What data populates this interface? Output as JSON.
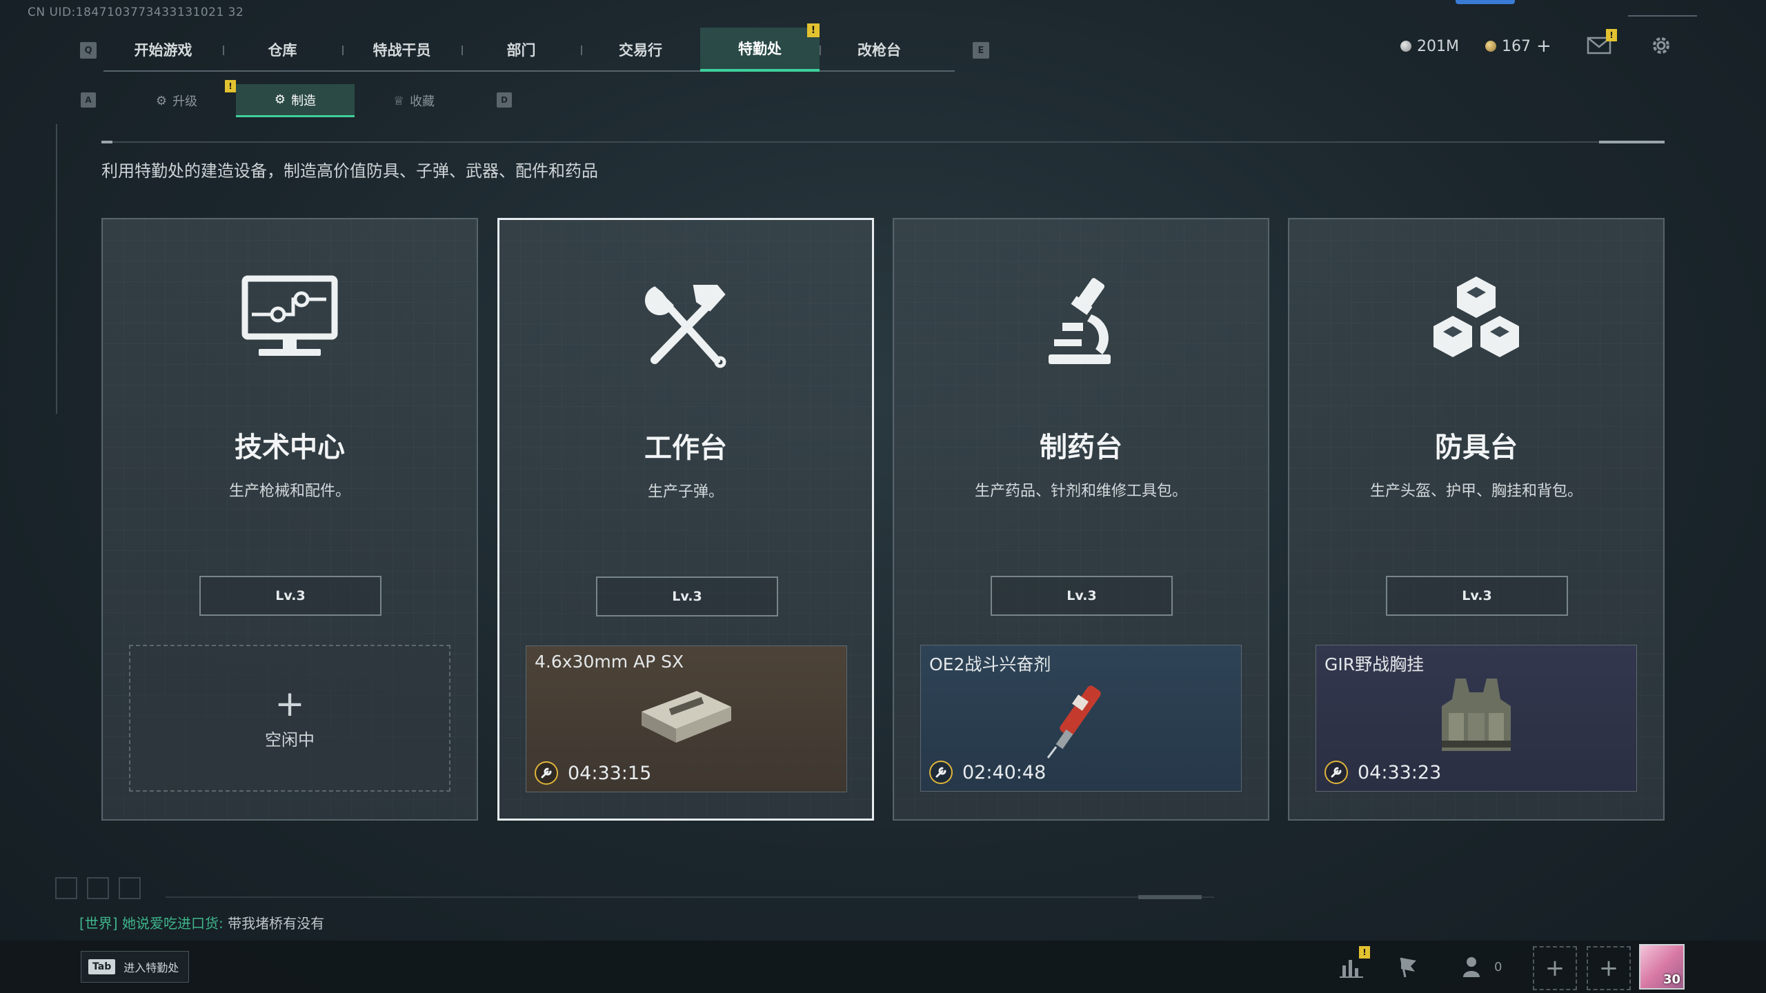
{
  "uid": "CN UID:1847103773433131021 32",
  "main_nav": {
    "key_left": "Q",
    "key_right": "E",
    "tabs": [
      {
        "label": "开始游戏"
      },
      {
        "label": "仓库"
      },
      {
        "label": "特战干员"
      },
      {
        "label": "部门"
      },
      {
        "label": "交易行"
      },
      {
        "label": "特勤处",
        "active": true,
        "badge": "!"
      },
      {
        "label": "改枪台"
      }
    ]
  },
  "sub_nav": {
    "key_left": "A",
    "key_right": "D",
    "tabs": [
      {
        "label": "升级",
        "badge": "!"
      },
      {
        "label": "制造",
        "active": true
      },
      {
        "label": "收藏"
      }
    ]
  },
  "currency": {
    "silver": "201M",
    "gold": "167",
    "add": "+",
    "mail_badge": "!"
  },
  "description": "利用特勤处的建造设备，制造高价值防具、子弹、武器、配件和药品",
  "cards": [
    {
      "icon": "monitor-icon",
      "title": "技术中心",
      "subtitle": "生产枪械和配件。",
      "level": "Lv.3",
      "slot": {
        "state": "empty",
        "plus": "+",
        "label": "空闲中"
      }
    },
    {
      "icon": "hammer-wrench-icon",
      "title": "工作台",
      "subtitle": "生产子弹。",
      "level": "Lv.3",
      "selected": true,
      "slot": {
        "state": "producing",
        "name": "4.6x30mm AP SX",
        "time": "04:33:15",
        "tone": "brown"
      }
    },
    {
      "icon": "microscope-icon",
      "title": "制药台",
      "subtitle": "生产药品、针剂和维修工具包。",
      "level": "Lv.3",
      "slot": {
        "state": "producing",
        "name": "OE2战斗兴奋剂",
        "time": "02:40:48",
        "tone": "blue"
      }
    },
    {
      "icon": "cubes-icon",
      "title": "防具台",
      "subtitle": "生产头盔、护甲、胸挂和背包。",
      "level": "Lv.3",
      "slot": {
        "state": "producing",
        "name": "GIR野战胸挂",
        "time": "04:33:23",
        "tone": "navy"
      }
    }
  ],
  "chat": {
    "channel": "[世界]",
    "user": "她说爱吃进口货:",
    "message": "带我堵桥有没有"
  },
  "bottom": {
    "tab_key": "Tab",
    "tab_label": "进入特勤处",
    "stats_badge": "!",
    "friend_count": "0",
    "avatar_level": "30"
  },
  "colors": {
    "accent_green": "#3fd19c",
    "badge_yellow": "#e2c230",
    "timer_ring": "#e0b53a"
  }
}
